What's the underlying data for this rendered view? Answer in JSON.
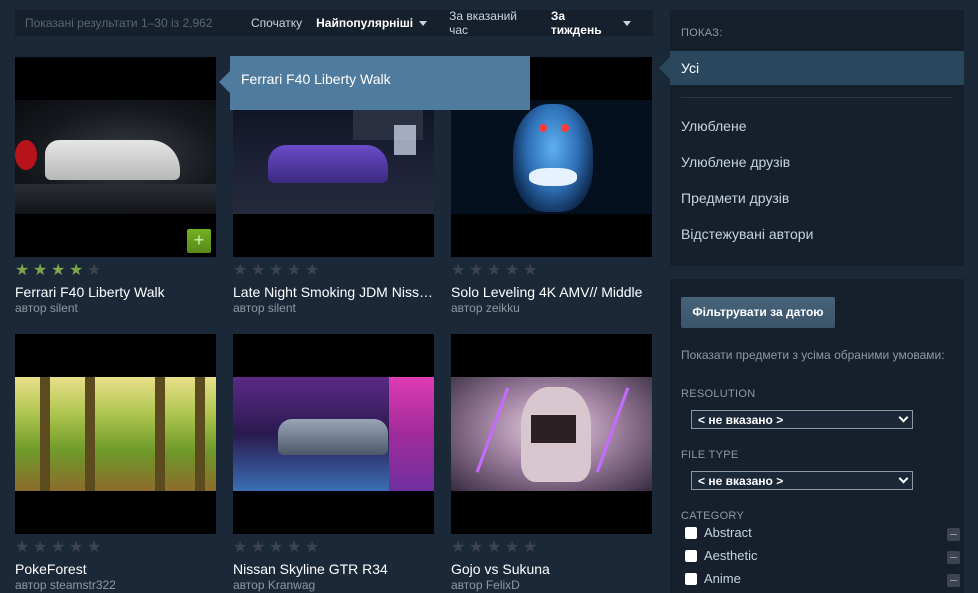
{
  "topbar": {
    "results": "Показані результати 1–30 із 2,962",
    "sort_label": "Спочатку",
    "sort_value": "Найпопулярніші",
    "time_label": "За вказаний час",
    "time_value": "За тиждень"
  },
  "tooltip": "Ferrari F40 Liberty Walk",
  "items": [
    {
      "title": "Ferrari F40 Liberty Walk",
      "author": "автор silent",
      "rating": 4,
      "image": "ferrari-image"
    },
    {
      "title": "Late Night Smoking JDM Nissan",
      "author": "автор silent",
      "rating": 0,
      "image": "jdm-image"
    },
    {
      "title": "Solo Leveling 4K AMV// Middle",
      "author": "автор zeikku",
      "rating": 0,
      "image": "solo-leveling-image"
    },
    {
      "title": "PokeForest",
      "author": "автор steamstr322",
      "rating": 0,
      "image": "forest-image"
    },
    {
      "title": "Nissan Skyline GTR R34",
      "author": "автор Kranwag",
      "rating": 0,
      "image": "nissan-image"
    },
    {
      "title": "Gojo vs Sukuna",
      "author": "автор FelixD",
      "rating": 0,
      "image": "gojo-image"
    }
  ],
  "add_icon": "plus-icon",
  "sidebar": {
    "show_header": "ПОКАЗ:",
    "active": "Усі",
    "items": [
      "Улюблене",
      "Улюблене друзів",
      "Предмети друзів",
      "Відстежувані автори"
    ]
  },
  "filters": {
    "date_button": "Фільтрувати за датою",
    "note": "Показати предмети з усіма обраними умовами:",
    "resolution_label": "RESOLUTION",
    "resolution_value": "< не вказано >",
    "filetype_label": "FILE TYPE",
    "filetype_value": "< не вказано >",
    "category_label": "CATEGORY",
    "categories": [
      "Abstract",
      "Aesthetic",
      "Anime"
    ]
  },
  "colors": {
    "background": "#1b2838",
    "panel": "#16202d",
    "tooltip": "#4f7b9e",
    "active_item": "#2a475e",
    "star_on": "#7ea64b",
    "star_off": "#3d4450"
  }
}
